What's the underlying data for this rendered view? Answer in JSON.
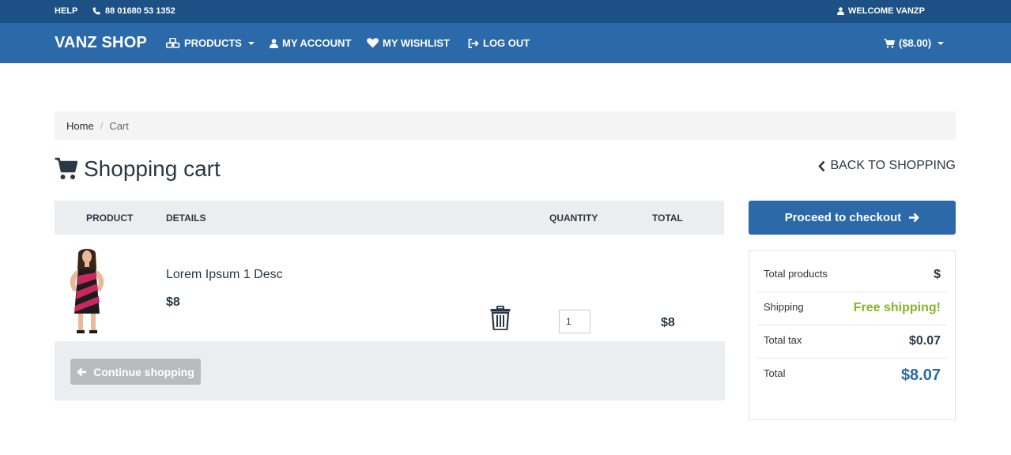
{
  "topbar": {
    "help": "HELP",
    "phone": "88 01680 53 1352",
    "welcome": "WELCOME VANZP"
  },
  "navbar": {
    "brand": "VANZ SHOP",
    "products": "PRODUCTS",
    "my_account": "MY ACCOUNT",
    "my_wishlist": "MY WISHLIST",
    "log_out": "LOG OUT",
    "cart_total": "($8.00)"
  },
  "breadcrumb": {
    "home": "Home",
    "separator": "/",
    "current": "Cart"
  },
  "page": {
    "title": "Shopping cart",
    "back_link": "BACK TO SHOPPING"
  },
  "cart": {
    "columns": {
      "product": "PRODUCT",
      "details": "DETAILS",
      "quantity": "QUANTITY",
      "total": "TOTAL"
    },
    "items": [
      {
        "name": "Lorem Ipsum 1 Desc",
        "price": "$8",
        "quantity": "1",
        "total": "$8"
      }
    ],
    "continue_label": "Continue shopping"
  },
  "checkout": {
    "label": "Proceed to checkout"
  },
  "summary": {
    "total_products_label": "Total products",
    "total_products_value": "$",
    "shipping_label": "Shipping",
    "shipping_value": "Free shipping!",
    "tax_label": "Total tax",
    "tax_value": "$0.07",
    "total_label": "Total",
    "total_value": "$8.07"
  },
  "colors": {
    "topbar": "#1d5185",
    "navbar": "#2c69a8",
    "accent_green": "#86b52a",
    "total_blue": "#2c69a8",
    "muted_button": "#b9bcbf"
  },
  "icons": {
    "phone": "phone-icon",
    "user": "user-icon",
    "products": "cubes-icon",
    "wishlist": "heart-icon",
    "logout": "sign-out-icon",
    "cart": "shopping-cart-icon",
    "back": "chevron-left-icon",
    "delete": "trash-icon",
    "continue": "arrow-left-icon",
    "checkout": "arrow-right-icon"
  }
}
